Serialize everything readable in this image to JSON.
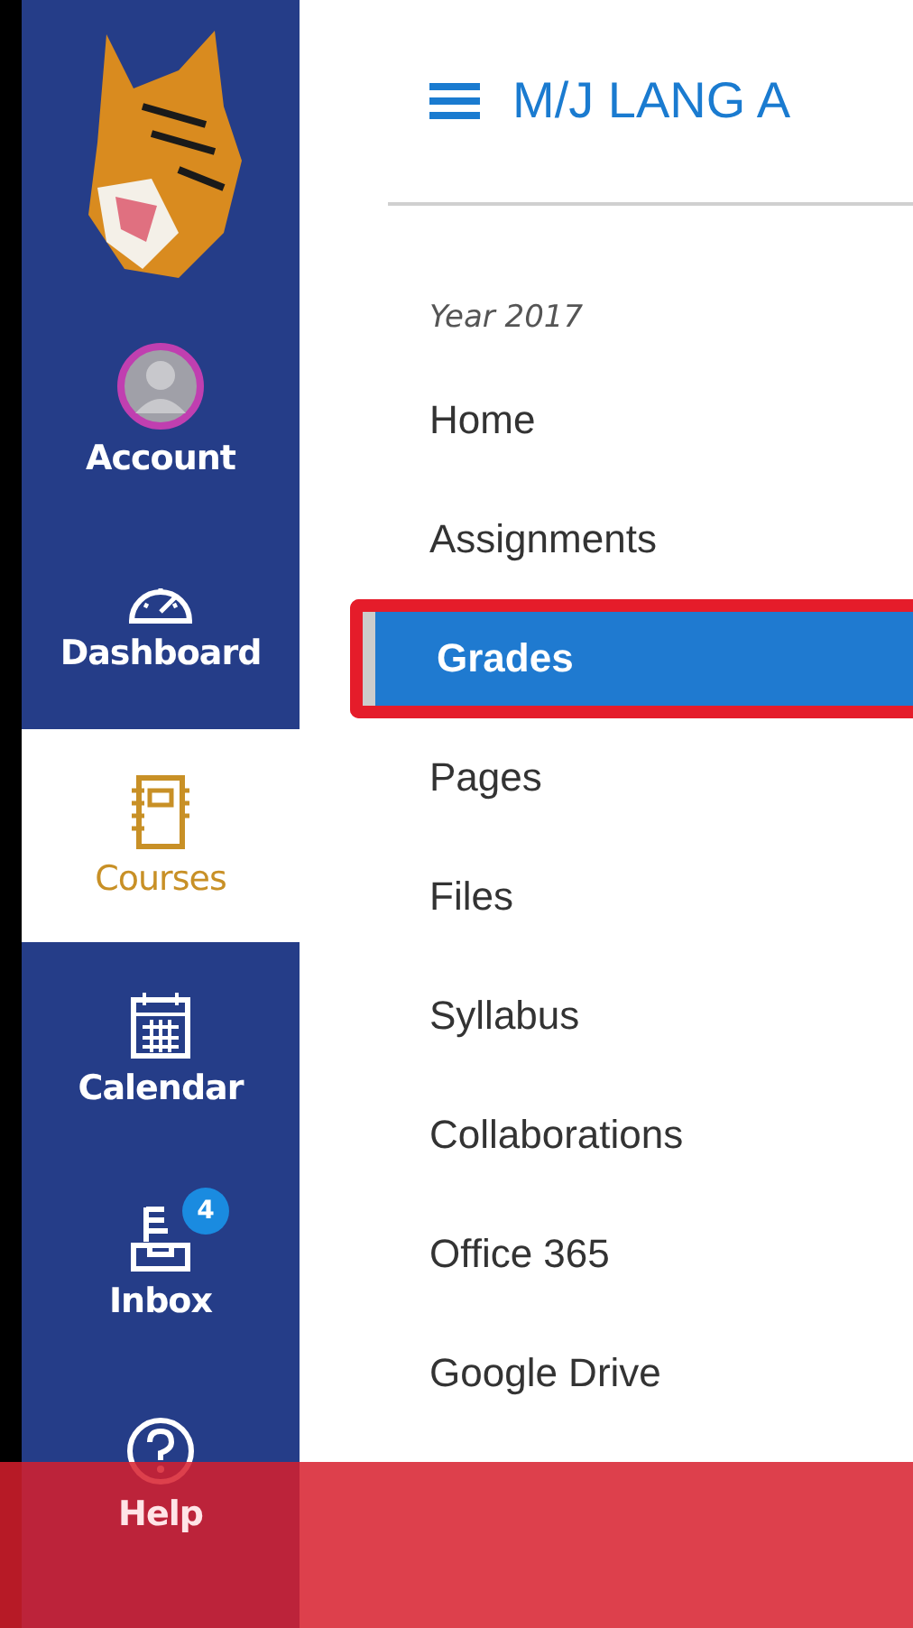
{
  "global_nav": [
    {
      "label": "Account",
      "kind": "account",
      "selected": false
    },
    {
      "label": "Dashboard",
      "kind": "dashboard",
      "selected": false
    },
    {
      "label": "Courses",
      "kind": "courses",
      "selected": true
    },
    {
      "label": "Calendar",
      "kind": "calendar",
      "selected": false
    },
    {
      "label": "Inbox",
      "kind": "inbox",
      "selected": false,
      "badge": "4"
    },
    {
      "label": "Help",
      "kind": "help",
      "selected": false
    }
  ],
  "header": {
    "title": "M/J LANG A"
  },
  "course_nav": {
    "term": "Year 2017",
    "items": [
      {
        "label": "Home",
        "selected": false
      },
      {
        "label": "Assignments",
        "selected": false
      },
      {
        "label": "Grades",
        "selected": true
      },
      {
        "label": "Pages",
        "selected": false
      },
      {
        "label": "Files",
        "selected": false
      },
      {
        "label": "Syllabus",
        "selected": false
      },
      {
        "label": "Collaborations",
        "selected": false
      },
      {
        "label": "Office 365",
        "selected": false
      },
      {
        "label": "Google Drive",
        "selected": false
      }
    ]
  }
}
